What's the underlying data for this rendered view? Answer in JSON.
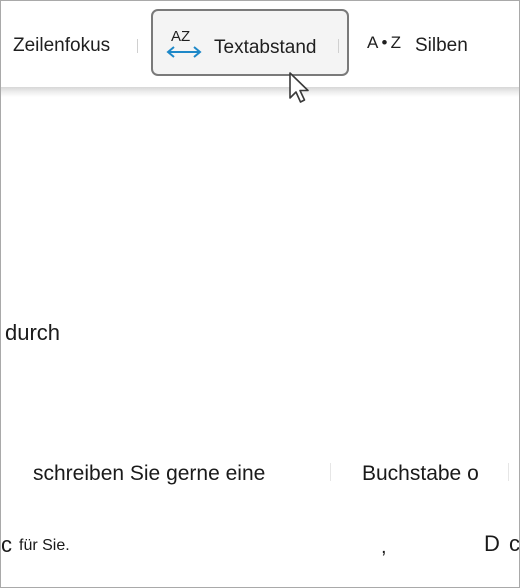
{
  "toolbar": {
    "zeilenfokus_label": "Zeilenfokus",
    "textabstand_label": "Textabstand",
    "textabstand_icon_text": "AZ",
    "silben_label": "Silben",
    "silben_icon_text": "A•Z"
  },
  "document": {
    "fragment_durch": "durch",
    "fragment_schreiben": "schreiben Sie gerne eine",
    "fragment_buchstabe": "Buchstabe o",
    "fragment_c_left": "c",
    "fragment_fuer_sie": "für Sie.",
    "fragment_comma": ",",
    "fragment_d": "D",
    "fragment_c_right": "c"
  },
  "colors": {
    "icon_accent": "#1e88c8",
    "button_border": "#7a7a7a",
    "button_bg": "#f4f4f4",
    "text": "#1f1f1f"
  },
  "icons": {
    "textabstand": "text-spacing-icon",
    "silben": "syllables-icon",
    "cursor": "mouse-pointer-icon"
  }
}
